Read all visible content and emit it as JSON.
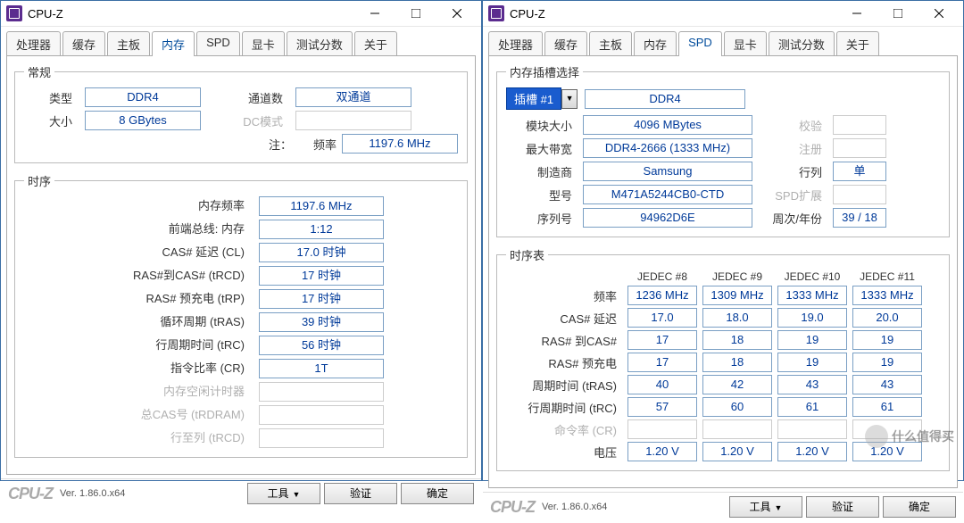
{
  "app_title": "CPU-Z",
  "tabs": [
    "处理器",
    "缓存",
    "主板",
    "内存",
    "SPD",
    "显卡",
    "测试分数",
    "关于"
  ],
  "left": {
    "active_tab": "内存",
    "general_legend": "常规",
    "timings_legend": "时序",
    "labels": {
      "type": "类型",
      "size": "大小",
      "channels": "通道数",
      "dc_mode": "DC模式",
      "note_prefix": "注：",
      "freq": "频率",
      "mem_freq": "内存频率",
      "fsb_mem": "前端总线: 内存",
      "cl": "CAS# 延迟 (CL)",
      "trcd": "RAS#到CAS# (tRCD)",
      "trp": "RAS# 预充电 (tRP)",
      "tras": "循环周期 (tRAS)",
      "trc": "行周期时间 (tRC)",
      "cr": "指令比率 (CR)",
      "idle": "内存空闲计时器",
      "trdram": "总CAS号 (tRDRAM)",
      "trcd2": "行至列 (tRCD)"
    },
    "values": {
      "type": "DDR4",
      "size": "8 GBytes",
      "channels": "双通道",
      "freq": "1197.6 MHz",
      "mem_freq": "1197.6 MHz",
      "fsb_mem": "1:12",
      "cl": "17.0 时钟",
      "trcd": "17 时钟",
      "trp": "17 时钟",
      "tras": "39 时钟",
      "trc": "56 时钟",
      "cr": "1T"
    }
  },
  "right": {
    "active_tab": "SPD",
    "slot_legend": "内存插槽选择",
    "timing_legend": "时序表",
    "slot_label": "插槽 #1",
    "slot_type": "DDR4",
    "labels": {
      "module_size": "模块大小",
      "max_bw": "最大带宽",
      "mfr": "制造商",
      "model": "型号",
      "serial": "序列号",
      "correction": "校验",
      "registered": "注册",
      "ranks": "行列",
      "spd_ext": "SPD扩展",
      "week_year": "周次/年份"
    },
    "values": {
      "module_size": "4096 MBytes",
      "max_bw": "DDR4-2666 (1333 MHz)",
      "mfr": "Samsung",
      "model": "M471A5244CB0-CTD",
      "serial": "94962D6E",
      "ranks": "单",
      "week_year": "39 / 18"
    },
    "table": {
      "headers": [
        "JEDEC #8",
        "JEDEC #9",
        "JEDEC #10",
        "JEDEC #11"
      ],
      "row_labels": [
        "频率",
        "CAS# 延迟",
        "RAS# 到CAS#",
        "RAS# 预充电",
        "周期时间 (tRAS)",
        "行周期时间 (tRC)",
        "命令率 (CR)",
        "电压"
      ],
      "rows": [
        [
          "1236 MHz",
          "1309 MHz",
          "1333 MHz",
          "1333 MHz"
        ],
        [
          "17.0",
          "18.0",
          "19.0",
          "20.0"
        ],
        [
          "17",
          "18",
          "19",
          "19"
        ],
        [
          "17",
          "18",
          "19",
          "19"
        ],
        [
          "40",
          "42",
          "43",
          "43"
        ],
        [
          "57",
          "60",
          "61",
          "61"
        ],
        [
          "",
          "",
          "",
          ""
        ],
        [
          "1.20 V",
          "1.20 V",
          "1.20 V",
          "1.20 V"
        ]
      ]
    }
  },
  "footer": {
    "logo": "CPU-Z",
    "ver": "Ver. 1.86.0.x64",
    "tools": "工具",
    "validate": "验证",
    "ok": "确定"
  },
  "watermark": "什么值得买"
}
